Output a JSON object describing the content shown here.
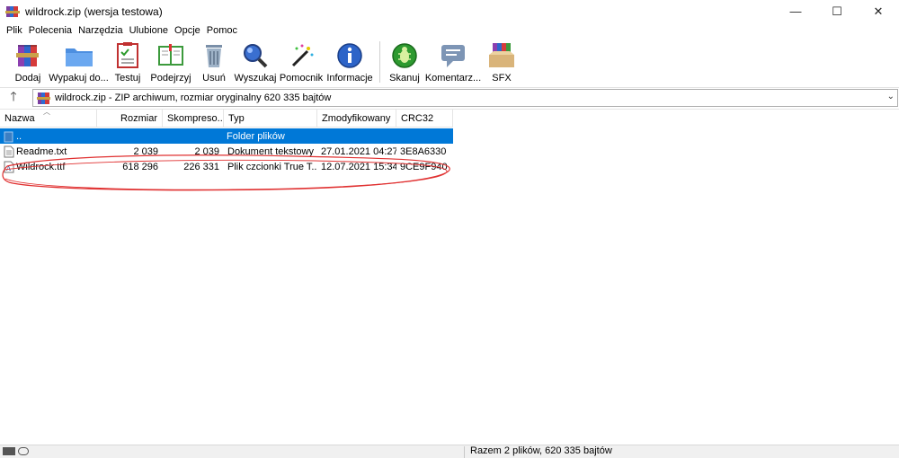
{
  "window": {
    "title": "wildrock.zip (wersja testowa)",
    "controls": {
      "minimize": "—",
      "maximize": "☐",
      "close": "✕"
    }
  },
  "menu": [
    "Plik",
    "Polecenia",
    "Narzędzia",
    "Ulubione",
    "Opcje",
    "Pomoc"
  ],
  "toolbar": [
    {
      "label": "Dodaj",
      "icon": "books-icon"
    },
    {
      "label": "Wypakuj do...",
      "icon": "folder-icon"
    },
    {
      "label": "Testuj",
      "icon": "checklist-icon"
    },
    {
      "label": "Podejrzyj",
      "icon": "book-icon"
    },
    {
      "label": "Usuń",
      "icon": "trash-icon"
    },
    {
      "label": "Wyszukaj",
      "icon": "magnifier-icon"
    },
    {
      "label": "Pomocnik",
      "icon": "magic-wand-icon"
    },
    {
      "label": "Informacje",
      "icon": "info-icon"
    },
    {
      "label": "Skanuj",
      "icon": "bug-icon"
    },
    {
      "label": "Komentarz...",
      "icon": "comment-icon"
    },
    {
      "label": "SFX",
      "icon": "sfx-box-icon"
    }
  ],
  "path": {
    "text": "wildrock.zip - ZIP archiwum, rozmiar oryginalny 620 335 bajtów",
    "up_arrow": "🡑",
    "dropdown": "⌄"
  },
  "columns": [
    "Nazwa",
    "Rozmiar",
    "Skompreso...",
    "Typ",
    "Zmodyfikowany",
    "CRC32"
  ],
  "folder_row": {
    "name": "..",
    "type": "Folder plików"
  },
  "files": [
    {
      "name": "Readme.txt",
      "size": "2 039",
      "packed": "2 039",
      "type": "Dokument tekstowy",
      "modified": "27.01.2021 04:27",
      "crc": "3E8A6330",
      "icon": "text-file-icon"
    },
    {
      "name": "Wildrock.ttf",
      "size": "618 296",
      "packed": "226 331",
      "type": "Plik czcionki True T...",
      "modified": "12.07.2021 15:34",
      "crc": "9CE9F940",
      "icon": "font-file-icon"
    }
  ],
  "status": {
    "text": "Razem 2 plików, 620 335 bajtów"
  },
  "colors": {
    "selection": "#0078d7",
    "annotation": "#e03030"
  }
}
